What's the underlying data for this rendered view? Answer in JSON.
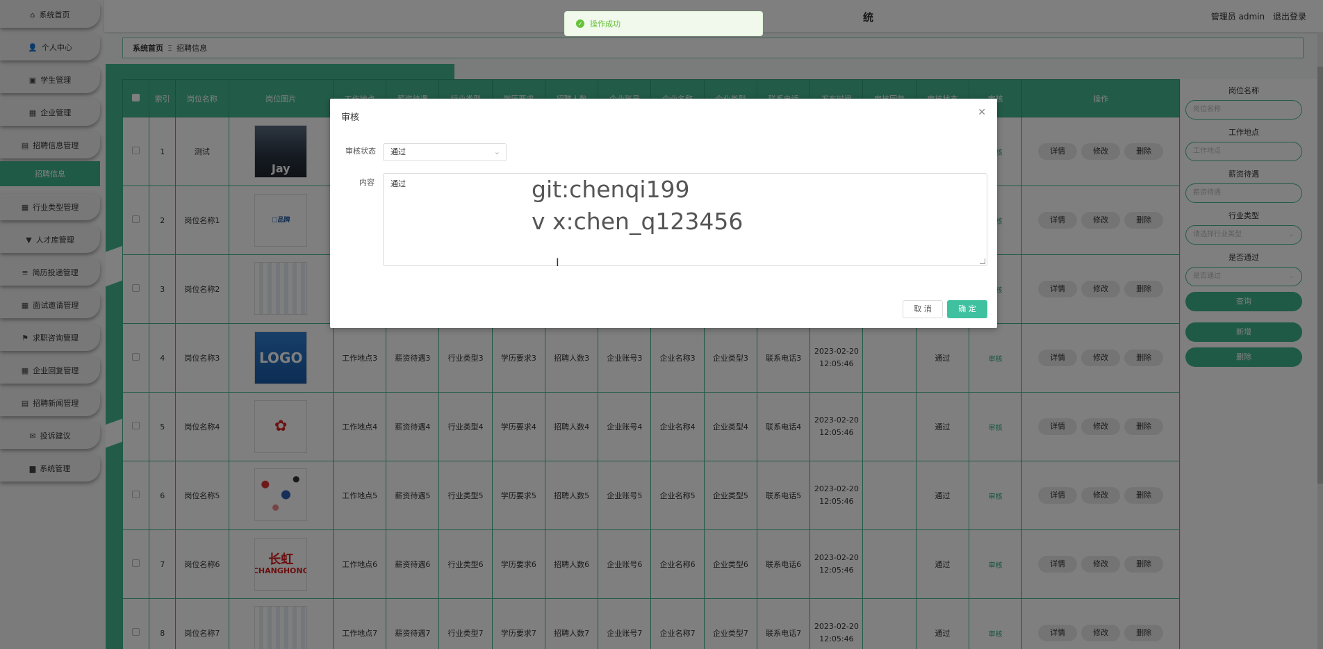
{
  "sidebar": {
    "items": [
      {
        "label": "系统首页",
        "icon": "home-icon",
        "glyph": "⌂"
      },
      {
        "label": "个人中心",
        "icon": "user-icon",
        "glyph": "👤"
      },
      {
        "label": "学生管理",
        "icon": "student-icon",
        "glyph": "▣"
      },
      {
        "label": "企业管理",
        "icon": "grid-icon",
        "glyph": "▦"
      },
      {
        "label": "招聘信息管理",
        "icon": "doc-icon",
        "glyph": "▤"
      },
      {
        "label": "行业类型管理",
        "icon": "grid-icon",
        "glyph": "▦"
      },
      {
        "label": "人才库管理",
        "icon": "bulb-icon",
        "glyph": "▼"
      },
      {
        "label": "简历投递管理",
        "icon": "list-icon",
        "glyph": "≡"
      },
      {
        "label": "面试邀请管理",
        "icon": "grid-icon",
        "glyph": "▦"
      },
      {
        "label": "求职咨询管理",
        "icon": "flag-icon",
        "glyph": "⚑"
      },
      {
        "label": "企业回复管理",
        "icon": "grid-icon",
        "glyph": "▦"
      },
      {
        "label": "招聘新闻管理",
        "icon": "doc-icon",
        "glyph": "▤"
      },
      {
        "label": "投诉建议",
        "icon": "chat-icon",
        "glyph": "✉"
      },
      {
        "label": "系统管理",
        "icon": "db-icon",
        "glyph": "▆"
      }
    ],
    "active_sub": "招聘信息"
  },
  "header": {
    "title_visible": "统",
    "user_role": "管理员 admin",
    "logout": "退出登录"
  },
  "breadcrumb": {
    "home": "系统首页",
    "sep": "Ξ",
    "current": "招聘信息"
  },
  "table": {
    "headers": [
      "",
      "索引",
      "岗位名称",
      "岗位图片",
      "工作地点",
      "薪资待遇",
      "行业类型",
      "学历要求",
      "招聘人数",
      "企业账号",
      "企业名称",
      "企业类型",
      "联系电话",
      "发布时间",
      "审核回复",
      "审核状态",
      "审核",
      "操作"
    ],
    "rows": [
      {
        "idx": "1",
        "name": "测试",
        "pic": "photo",
        "pic_text": "Jay",
        "loc": "",
        "salary": "",
        "industry": "",
        "edu": "",
        "count": "",
        "acct": "",
        "company": "",
        "ctype": "",
        "phone": "",
        "time": "",
        "reply": "",
        "status": "",
        "audit": "审核"
      },
      {
        "idx": "2",
        "name": "岗位名称1",
        "pic": "logo",
        "pic_text": "□品牌",
        "loc": "",
        "salary": "",
        "industry": "",
        "edu": "",
        "count": "",
        "acct": "",
        "company": "",
        "ctype": "",
        "phone": "",
        "time": "",
        "reply": "",
        "status": "",
        "audit": "审核"
      },
      {
        "idx": "3",
        "name": "岗位名称2",
        "pic": "grid",
        "pic_text": "",
        "loc": "",
        "salary": "",
        "industry": "",
        "edu": "",
        "count": "",
        "acct": "",
        "company": "",
        "ctype": "",
        "phone": "",
        "time": "",
        "reply": "",
        "status": "",
        "audit": "审核"
      },
      {
        "idx": "4",
        "name": "岗位名称3",
        "pic": "blue",
        "pic_text": "LOGO",
        "loc": "工作地点3",
        "salary": "薪资待遇3",
        "industry": "行业类型3",
        "edu": "学历要求3",
        "count": "招聘人数3",
        "acct": "企业账号3",
        "company": "企业名称3",
        "ctype": "企业类型3",
        "phone": "联系电话3",
        "time": "2023-02-20 12:05:46",
        "reply": "",
        "status": "通过",
        "audit": "审核"
      },
      {
        "idx": "5",
        "name": "岗位名称4",
        "pic": "red",
        "pic_text": "✿",
        "loc": "工作地点4",
        "salary": "薪资待遇4",
        "industry": "行业类型4",
        "edu": "学历要求4",
        "count": "招聘人数4",
        "acct": "企业账号4",
        "company": "企业名称4",
        "ctype": "企业类型4",
        "phone": "联系电话4",
        "time": "2023-02-20 12:05:46",
        "reply": "",
        "status": "通过",
        "audit": "审核"
      },
      {
        "idx": "6",
        "name": "岗位名称5",
        "pic": "many",
        "pic_text": "",
        "loc": "工作地点5",
        "salary": "薪资待遇5",
        "industry": "行业类型5",
        "edu": "学历要求5",
        "count": "招聘人数5",
        "acct": "企业账号5",
        "company": "企业名称5",
        "ctype": "企业类型5",
        "phone": "联系电话5",
        "time": "2023-02-20 12:05:46",
        "reply": "",
        "status": "通过",
        "audit": "审核"
      },
      {
        "idx": "7",
        "name": "岗位名称6",
        "pic": "ch",
        "pic_text": "长虹",
        "pic_sub": "CHANGHONG",
        "loc": "工作地点6",
        "salary": "薪资待遇6",
        "industry": "行业类型6",
        "edu": "学历要求6",
        "count": "招聘人数6",
        "acct": "企业账号6",
        "company": "企业名称6",
        "ctype": "企业类型6",
        "phone": "联系电话6",
        "time": "2023-02-20 12:05:46",
        "reply": "",
        "status": "通过",
        "audit": "审核"
      },
      {
        "idx": "8",
        "name": "岗位名称7",
        "pic": "grid",
        "pic_text": "",
        "loc": "工作地点7",
        "salary": "薪资待遇7",
        "industry": "行业类型7",
        "edu": "学历要求7",
        "count": "招聘人数7",
        "acct": "企业账号7",
        "company": "企业名称7",
        "ctype": "企业类型7",
        "phone": "联系电话7",
        "time": "2023-02-20 12:05:46",
        "reply": "",
        "status": "通过",
        "audit": "审核"
      }
    ],
    "actions": {
      "detail": "详情",
      "edit": "修改",
      "delete": "删除"
    }
  },
  "filters": {
    "job_name_label": "岗位名称",
    "job_name_placeholder": "岗位名称",
    "location_label": "工作地点",
    "location_placeholder": "工作地点",
    "salary_label": "薪资待遇",
    "salary_placeholder": "薪资待遇",
    "industry_label": "行业类型",
    "industry_placeholder": "请选择行业类型",
    "passed_label": "是否通过",
    "passed_placeholder": "是否通过",
    "search": "查询",
    "add": "新增",
    "delete": "删除"
  },
  "modal": {
    "title": "审核",
    "status_label": "审核状态",
    "status_value": "通过",
    "content_label": "内容",
    "content_value": "通过",
    "cancel": "取 消",
    "confirm": "确 定"
  },
  "watermark": {
    "line1": "git:chenqi199",
    "line2": "v x:chen_q123456"
  },
  "toast": {
    "message": "操作成功"
  },
  "colors": {
    "accent": "#3fb58d",
    "header_bg": "#44b890",
    "confirm": "#3fc1a0",
    "success": "#67c23a"
  }
}
